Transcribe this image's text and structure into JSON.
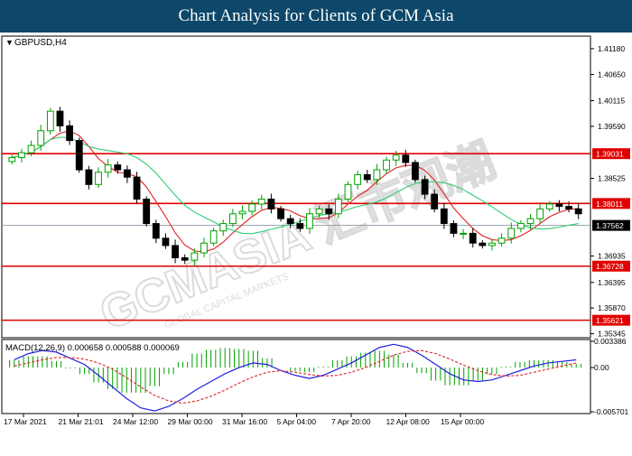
{
  "page_title": "Chart Analysis for Clients of GCM Asia",
  "watermark": "GCMASIA 汇市观潮",
  "watermark_small": "GLOBAL CAPITAL MARKETS",
  "chart_data": [
    {
      "type": "candlestick",
      "symbol_label": "GBPUSD,H4",
      "price_ticks": [
        "1.41180",
        "1.40650",
        "1.40115",
        "1.39590",
        "1.39031",
        "1.38525",
        "1.38011",
        "1.37562",
        "1.36935",
        "1.36728",
        "1.36395",
        "1.35870",
        "1.35621",
        "1.35345"
      ],
      "ylim": [
        1.353,
        1.414
      ],
      "x_tick_labels": [
        "17 Mar 2021",
        "21 Mar 21:01",
        "24 Mar 12:00",
        "29 Mar 00:00",
        "31 Mar 16:00",
        "5 Apr 04:00",
        "7 Apr 20:00",
        "12 Apr 08:00",
        "15 Apr 00:00"
      ],
      "horizontal_levels": [
        {
          "value": 1.39031,
          "label": "1.39031",
          "color": "#e00000"
        },
        {
          "value": 1.38011,
          "label": "1.38011",
          "color": "#e00000"
        },
        {
          "value": 1.36728,
          "label": "1.36728",
          "color": "#e00000"
        },
        {
          "value": 1.35621,
          "label": "1.35621",
          "color": "#e00000"
        }
      ],
      "current_price": {
        "value": 1.37562,
        "label": "1.37562"
      },
      "close_series": [
        1.3895,
        1.3905,
        1.392,
        1.395,
        1.399,
        1.396,
        1.393,
        1.387,
        1.384,
        1.3865,
        1.388,
        1.387,
        1.3855,
        1.381,
        1.376,
        1.373,
        1.3715,
        1.369,
        1.3685,
        1.37,
        1.372,
        1.3745,
        1.376,
        1.378,
        1.3785,
        1.38,
        1.381,
        1.379,
        1.377,
        1.376,
        1.375,
        1.378,
        1.379,
        1.378,
        1.381,
        1.384,
        1.386,
        1.385,
        1.387,
        1.389,
        1.39,
        1.3885,
        1.385,
        1.382,
        1.379,
        1.376,
        1.374,
        1.374,
        1.372,
        1.3715,
        1.372,
        1.373,
        1.375,
        1.376,
        1.377,
        1.379,
        1.38,
        1.3795,
        1.379,
        1.378
      ],
      "ma_fast_color": "#e02020",
      "ma_slow_color": "#2ecc71",
      "up_candle_color": "#00a000",
      "down_candle_color": "#000000"
    },
    {
      "type": "macd",
      "label": "MACD(12,26,9) 0.000658 0.000588 0.000069",
      "ticks": [
        "0.003386",
        "0.00",
        "-0.005701"
      ],
      "ylim": [
        -0.005701,
        0.003386
      ],
      "macd_line_color": "#2020e0",
      "signal_line_color": "#e02020",
      "histogram_color": "#00a000",
      "macd": [
        0.001,
        0.0018,
        0.0022,
        0.002,
        0.0012,
        0.0004,
        -0.001,
        -0.0025,
        -0.004,
        -0.0052,
        -0.0056,
        -0.005,
        -0.004,
        -0.0028,
        -0.0018,
        -0.0008,
        0.0,
        0.0006,
        0.0004,
        -0.0004,
        -0.001,
        -0.0014,
        -0.001,
        -0.0002,
        0.0006,
        0.0016,
        0.0026,
        0.003,
        0.0026,
        0.0016,
        0.0004,
        -0.0008,
        -0.0016,
        -0.0018,
        -0.0016,
        -0.001,
        -0.0004,
        0.0002,
        0.0006,
        0.0008,
        0.001
      ],
      "signal": [
        0.0002,
        0.0006,
        0.001,
        0.0013,
        0.0013,
        0.0011,
        0.0006,
        -0.0002,
        -0.0013,
        -0.0025,
        -0.0036,
        -0.0043,
        -0.0046,
        -0.0043,
        -0.0037,
        -0.0029,
        -0.002,
        -0.0012,
        -0.0006,
        -0.0004,
        -0.0006,
        -0.0009,
        -0.0011,
        -0.001,
        -0.0006,
        0.0,
        0.0008,
        0.0016,
        0.0021,
        0.0022,
        0.0018,
        0.0011,
        0.0003,
        -0.0004,
        -0.0009,
        -0.0011,
        -0.001,
        -0.0006,
        -0.0002,
        0.0002,
        0.0006
      ]
    }
  ]
}
